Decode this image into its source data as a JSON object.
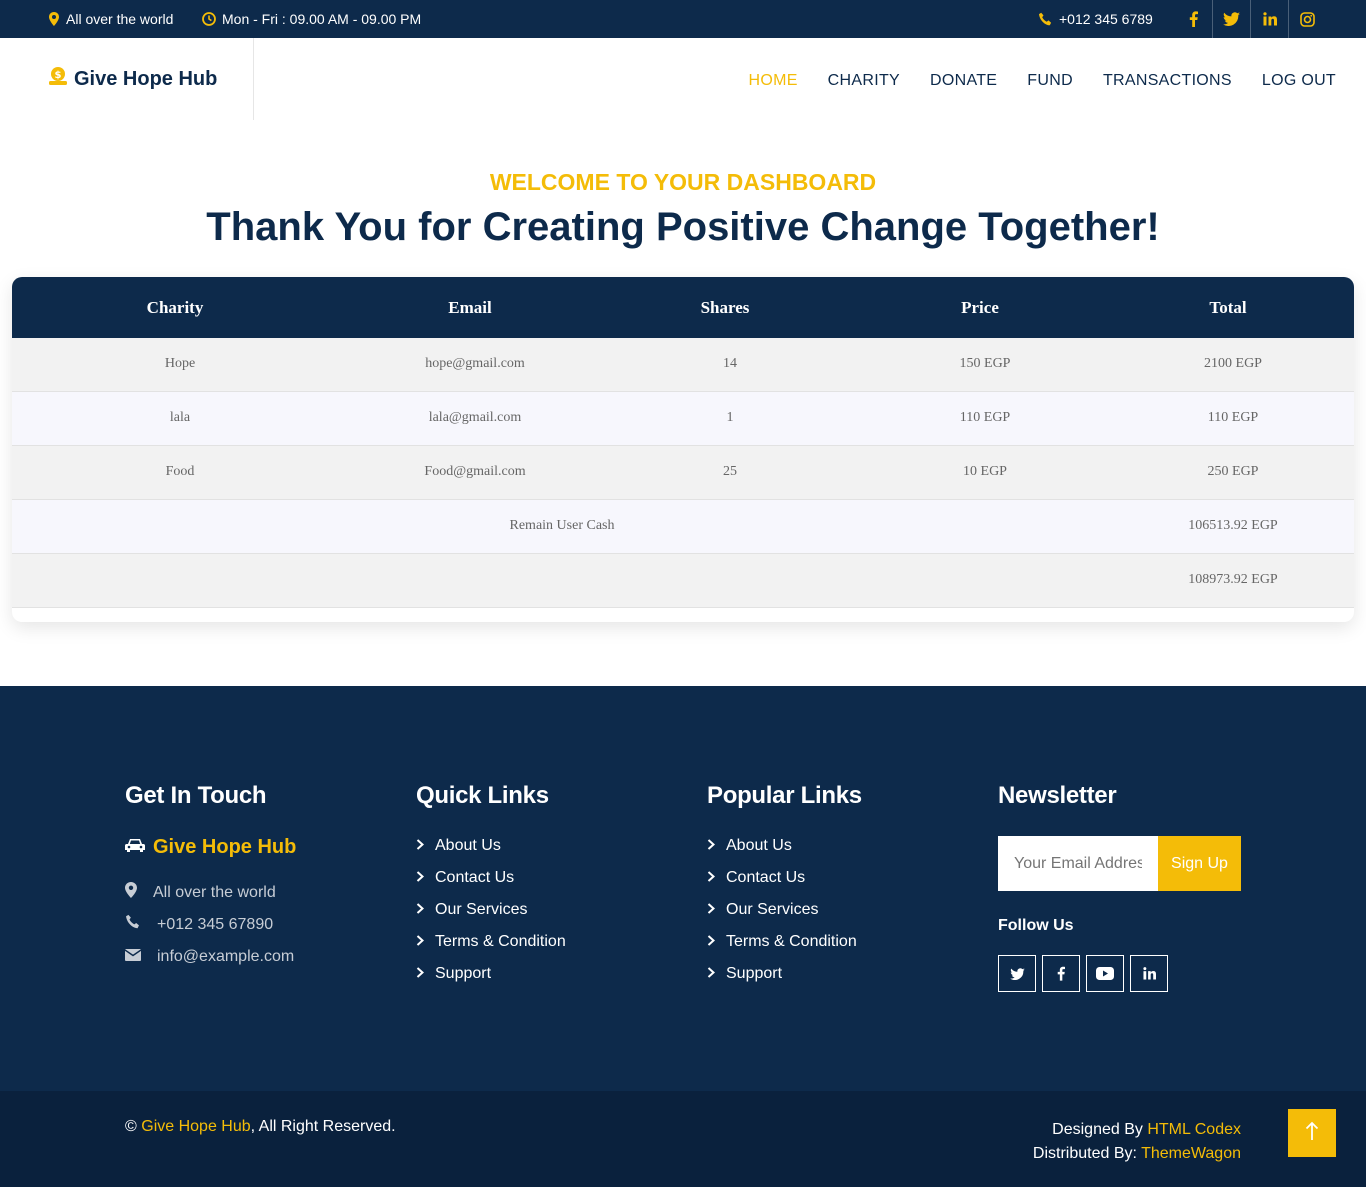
{
  "topbar": {
    "location": "All over the world",
    "hours": "Mon - Fri : 09.00 AM - 09.00 PM",
    "phone": "+012 345 6789",
    "icons": [
      "map-marker-icon",
      "clock-icon",
      "phone-icon",
      "facebook-icon",
      "twitter-icon",
      "linkedin-icon",
      "instagram-icon"
    ]
  },
  "navbar": {
    "brand": "Give Hope Hub",
    "items": [
      {
        "label": "HOME",
        "active": true
      },
      {
        "label": "CHARITY",
        "active": false
      },
      {
        "label": "DONATE",
        "active": false
      },
      {
        "label": "FUND",
        "active": false
      },
      {
        "label": "TRANSACTIONS",
        "active": false
      },
      {
        "label": "LOG OUT",
        "active": false
      }
    ]
  },
  "hero": {
    "subtitle": "WELCOME TO YOUR DASHBOARD",
    "title": "Thank You for Creating Positive Change Together!"
  },
  "table": {
    "headers": [
      "Charity",
      "Email",
      "Shares",
      "Price",
      "Total"
    ],
    "rows": [
      {
        "charity": "Hope",
        "email": "hope@gmail.com",
        "shares": "14",
        "price": "150 EGP",
        "total": "2100 EGP"
      },
      {
        "charity": "lala",
        "email": "lala@gmail.com",
        "shares": "1",
        "price": "110 EGP",
        "total": "110 EGP"
      },
      {
        "charity": "Food",
        "email": "Food@gmail.com",
        "shares": "25",
        "price": "10 EGP",
        "total": "250 EGP"
      }
    ],
    "remain_label": "Remain User Cash",
    "remain_value": "106513.92 EGP",
    "grand_total": "108973.92 EGP"
  },
  "footer": {
    "get_in_touch": {
      "heading": "Get In Touch",
      "brand": "Give Hope Hub",
      "address": "All over the world",
      "phone": "+012 345 67890",
      "email": "info@example.com"
    },
    "quick_links": {
      "heading": "Quick Links",
      "items": [
        "About Us",
        "Contact Us",
        "Our Services",
        "Terms & Condition",
        "Support"
      ]
    },
    "popular_links": {
      "heading": "Popular Links",
      "items": [
        "About Us",
        "Contact Us",
        "Our Services",
        "Terms & Condition",
        "Support"
      ]
    },
    "newsletter": {
      "heading": "Newsletter",
      "placeholder": "Your Email Address",
      "button": "Sign Up",
      "follow": "Follow Us"
    }
  },
  "copyright": {
    "prefix": "©",
    "brand": "Give Hope Hub",
    "suffix": ", All Right Reserved.",
    "designed_by": "Designed By",
    "designer": "HTML Codex",
    "distributed_by": "Distributed By:",
    "distributor": "ThemeWagon"
  },
  "colors": {
    "navy": "#0d2a4b",
    "accent": "#f4bc08",
    "footer_bottom": "#0a213d"
  }
}
